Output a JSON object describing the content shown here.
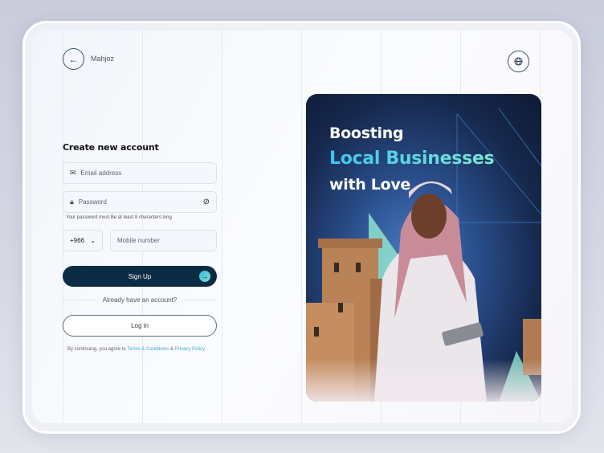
{
  "header": {
    "brand": "Mahjoz",
    "back_icon": "arrow-left-icon",
    "language_icon": "globe-icon"
  },
  "form": {
    "title": "Create new account",
    "email_placeholder": "Email address",
    "password_placeholder": "Password",
    "password_hint": "Your password must Be at least 8 characters long",
    "country_code": "+966",
    "mobile_placeholder": "Mobile number",
    "signup_label": "Sign Up",
    "already_text": "Already have an account?",
    "login_label": "Log in",
    "terms_prefix": "By continuing, you agree to",
    "terms_link": "Terms & Conditions",
    "terms_and": "&",
    "privacy_link": "Privacy Policy"
  },
  "hero": {
    "line1": "Boosting",
    "line2": "Local Businesses",
    "line3": "with Love"
  },
  "colors": {
    "primary": "#0c2c45",
    "accent": "#3aa8d8"
  }
}
